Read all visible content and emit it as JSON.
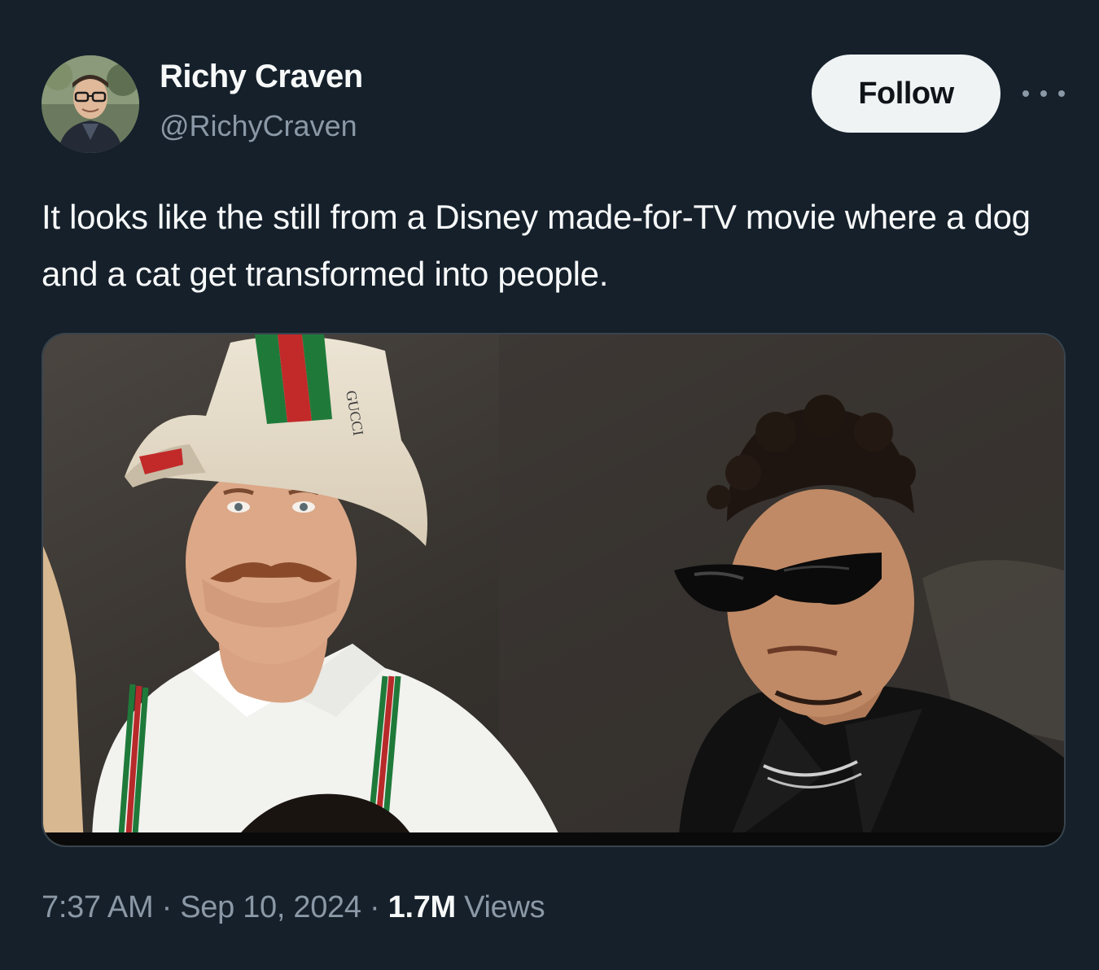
{
  "author": {
    "display_name": "Richy Craven",
    "handle": "@RichyCraven"
  },
  "actions": {
    "follow_label": "Follow"
  },
  "tweet": {
    "text": "It looks like the still from a Disney made-for-TV movie where a dog and a cat get transformed into people.",
    "time": "7:37 AM",
    "date": "Sep 10, 2024",
    "separator": "·",
    "views_count": "1.7M",
    "views_label": "Views"
  },
  "media": {
    "hat_brand_text": "GUCCI"
  },
  "icons": {
    "more": "more-horizontal-icon"
  },
  "colors": {
    "background": "#15202b",
    "primary_text": "#f7f9f9",
    "secondary_text": "#8b98a5",
    "follow_button_bg": "#eff3f4",
    "follow_button_text": "#0f1419",
    "border": "#38444d"
  }
}
